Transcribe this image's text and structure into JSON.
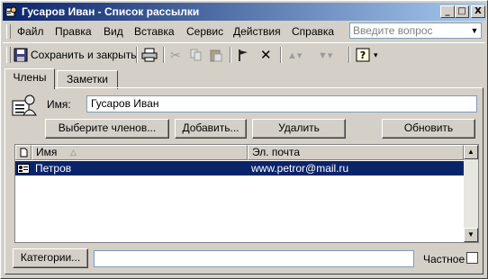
{
  "window": {
    "title": "Гусаров Иван - Список рассылки"
  },
  "title_buttons": {
    "minimize": "_",
    "maximize": "□",
    "close": "X"
  },
  "menu": {
    "items": [
      "Файл",
      "Правка",
      "Вид",
      "Вставка",
      "Сервис",
      "Действия",
      "Справка"
    ],
    "ask_placeholder": "Введите вопрос"
  },
  "toolbar": {
    "save_close_label": "Сохранить и закрыть"
  },
  "tabs": [
    {
      "label": "Члены",
      "active": true
    },
    {
      "label": "Заметки",
      "active": false
    }
  ],
  "members": {
    "name_label": "Имя:",
    "name_value": "Гусаров Иван",
    "select_members_button": "Выберите членов...",
    "add_button": "Добавить...",
    "delete_button": "Удалить",
    "update_button": "Обновить"
  },
  "list": {
    "columns": [
      "Имя",
      "Эл. почта"
    ],
    "rows": [
      {
        "name": "Петров",
        "email": "www.petror@mail.ru",
        "selected": true
      }
    ]
  },
  "footer": {
    "categories_button": "Категории...",
    "categories_value": "",
    "private_label": "Частное",
    "private_checked": false
  },
  "colors": {
    "title_start": "#0a246a",
    "title_end": "#a6caf0",
    "selection": "#0a246a",
    "face": "#d4d0c8"
  }
}
